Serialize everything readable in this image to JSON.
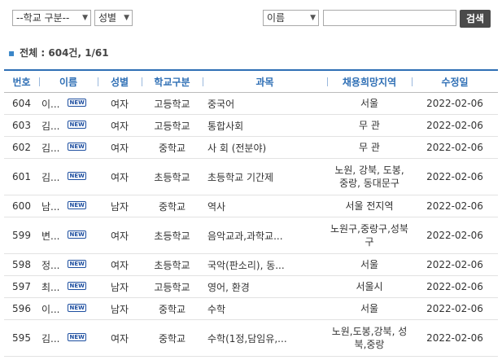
{
  "filters": {
    "school_type": "--학교 구분--",
    "gender": "성별",
    "search_field": "이름",
    "search_value": "",
    "search_button": "검색"
  },
  "summary": "전체 : 604건, 1/61",
  "table": {
    "headers": [
      "번호",
      "이름",
      "성별",
      "학교구분",
      "과목",
      "채용희망지역",
      "수정일"
    ],
    "new_badge": "NEW",
    "rows": [
      {
        "no": "604",
        "name": "이...",
        "gender": "여자",
        "school": "고등학교",
        "subject": "중국어",
        "region": "서울",
        "date": "2022-02-06"
      },
      {
        "no": "603",
        "name": "김...",
        "gender": "여자",
        "school": "고등학교",
        "subject": "통합사회",
        "region": "무 관",
        "date": "2022-02-06"
      },
      {
        "no": "602",
        "name": "김...",
        "gender": "여자",
        "school": "중학교",
        "subject": "사 회 (전분야)",
        "region": "무 관",
        "date": "2022-02-06"
      },
      {
        "no": "601",
        "name": "김...",
        "gender": "여자",
        "school": "초등학교",
        "subject": "초등학교 기간제",
        "region": "노원, 강북, 도봉, 중랑, 동대문구",
        "date": "2022-02-06"
      },
      {
        "no": "600",
        "name": "남...",
        "gender": "남자",
        "school": "중학교",
        "subject": "역사",
        "region": "서울 전지역",
        "date": "2022-02-06"
      },
      {
        "no": "599",
        "name": "변...",
        "gender": "여자",
        "school": "초등학교",
        "subject": "음악교과,과학교...",
        "region": "노원구,중랑구,성북구",
        "date": "2022-02-06"
      },
      {
        "no": "598",
        "name": "정...",
        "gender": "여자",
        "school": "초등학교",
        "subject": "국악(판소리), 동...",
        "region": "서울",
        "date": "2022-02-06"
      },
      {
        "no": "597",
        "name": "최...",
        "gender": "남자",
        "school": "고등학교",
        "subject": "영어, 환경",
        "region": "서울시",
        "date": "2022-02-06"
      },
      {
        "no": "596",
        "name": "이...",
        "gender": "남자",
        "school": "중학교",
        "subject": "수학",
        "region": "서울",
        "date": "2022-02-06"
      },
      {
        "no": "595",
        "name": "김...",
        "gender": "여자",
        "school": "중학교",
        "subject": "수학(1정,담임유,...",
        "region": "노원,도봉,강북, 성북,중랑",
        "date": "2022-02-06"
      }
    ]
  }
}
